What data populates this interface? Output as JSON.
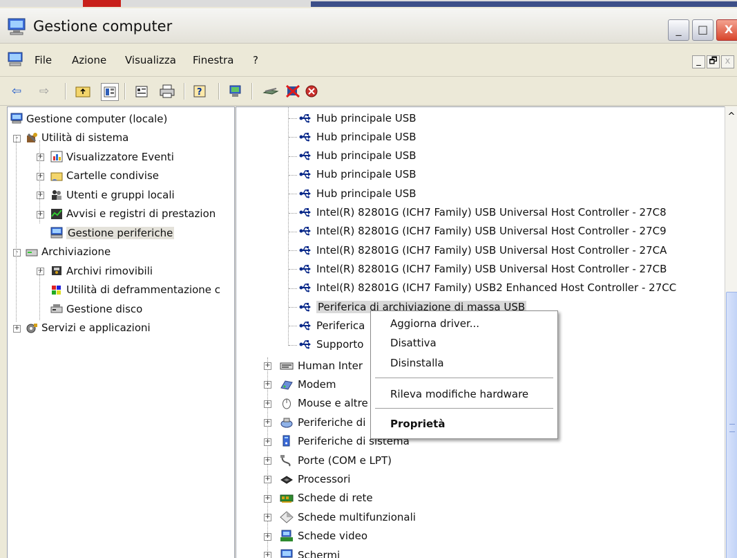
{
  "window": {
    "title": "Gestione computer",
    "buttons": {
      "minimize": "_",
      "maximize": "□",
      "close": "X"
    }
  },
  "menu": [
    "File",
    "Azione",
    "Visualizza",
    "Finestra",
    "?"
  ],
  "mdi_buttons": [
    "_",
    "🗗",
    "x"
  ],
  "toolbar_icons": [
    "back-arrow-icon",
    "forward-arrow-icon",
    "up-folder-icon",
    "show-tree-icon",
    "properties-icon",
    "print-icon",
    "help-icon",
    "scan-hardware-icon",
    "update-driver-icon",
    "disable-icon",
    "uninstall-icon"
  ],
  "left_tree": [
    {
      "label": "Gestione computer (locale)",
      "icon": "computer-icon",
      "level": 0,
      "expander": ""
    },
    {
      "label": "Utilità di sistema",
      "icon": "tools-icon",
      "level": 1,
      "expander": "-"
    },
    {
      "label": "Visualizzatore Eventi",
      "icon": "event-viewer-icon",
      "level": 2,
      "expander": "+"
    },
    {
      "label": "Cartelle condivise",
      "icon": "shared-folder-icon",
      "level": 2,
      "expander": "+"
    },
    {
      "label": "Utenti e gruppi locali",
      "icon": "users-icon",
      "level": 2,
      "expander": "+"
    },
    {
      "label": "Avvisi e registri di prestazion",
      "icon": "performance-icon",
      "level": 2,
      "expander": "+"
    },
    {
      "label": "Gestione periferiche",
      "icon": "device-manager-icon",
      "level": 2,
      "expander": "",
      "selected": true
    },
    {
      "label": "Archiviazione",
      "icon": "storage-icon",
      "level": 1,
      "expander": "-"
    },
    {
      "label": "Archivi rimovibili",
      "icon": "removable-storage-icon",
      "level": 2,
      "expander": "+"
    },
    {
      "label": "Utilità di deframmentazione c",
      "icon": "defrag-icon",
      "level": 2,
      "expander": ""
    },
    {
      "label": "Gestione disco",
      "icon": "disk-management-icon",
      "level": 2,
      "expander": ""
    },
    {
      "label": "Servizi e applicazioni",
      "icon": "services-icon",
      "level": 1,
      "expander": "+"
    }
  ],
  "usb_devices": [
    "Hub principale USB",
    "Hub principale USB",
    "Hub principale USB",
    "Hub principale USB",
    "Hub principale USB",
    "Intel(R) 82801G (ICH7 Family) USB Universal Host Controller - 27C8",
    "Intel(R) 82801G (ICH7 Family) USB Universal Host Controller - 27C9",
    "Intel(R) 82801G (ICH7 Family) USB Universal Host Controller - 27CA",
    "Intel(R) 82801G (ICH7 Family) USB Universal Host Controller - 27CB",
    "Intel(R) 82801G (ICH7 Family) USB2 Enhanced Host Controller - 27CC",
    "Periferica di archiviazione di massa USB",
    "Periferica",
    "Supporto"
  ],
  "categories": [
    {
      "label": "Human Inter",
      "icon": "hid-icon"
    },
    {
      "label": "Modem",
      "icon": "modem-icon"
    },
    {
      "label": "Mouse e altre",
      "icon": "mouse-icon"
    },
    {
      "label": "Periferiche di",
      "icon": "network-device-icon"
    },
    {
      "label": "Periferiche di sistema",
      "icon": "system-device-icon"
    },
    {
      "label": "Porte (COM e LPT)",
      "icon": "port-icon"
    },
    {
      "label": "Processori",
      "icon": "processor-icon"
    },
    {
      "label": "Schede di rete",
      "icon": "network-card-icon"
    },
    {
      "label": "Schede multifunzionali",
      "icon": "multifunction-icon"
    },
    {
      "label": "Schede video",
      "icon": "video-card-icon"
    },
    {
      "label": "Schermi",
      "icon": "monitor-icon"
    }
  ],
  "context_menu": {
    "update_driver": "Aggiorna driver...",
    "disable": "Disattiva",
    "uninstall": "Disinstalla",
    "scan_hardware": "Rileva modifiche hardware",
    "properties": "Proprietà"
  },
  "scrollbar": {
    "up_arrow": "^"
  },
  "colors": {
    "selection": "#d9d9d9",
    "title_gradient_top": "#f6f6f4",
    "close_button": "#d8462c",
    "usb_icon": "#0a2a8a"
  }
}
